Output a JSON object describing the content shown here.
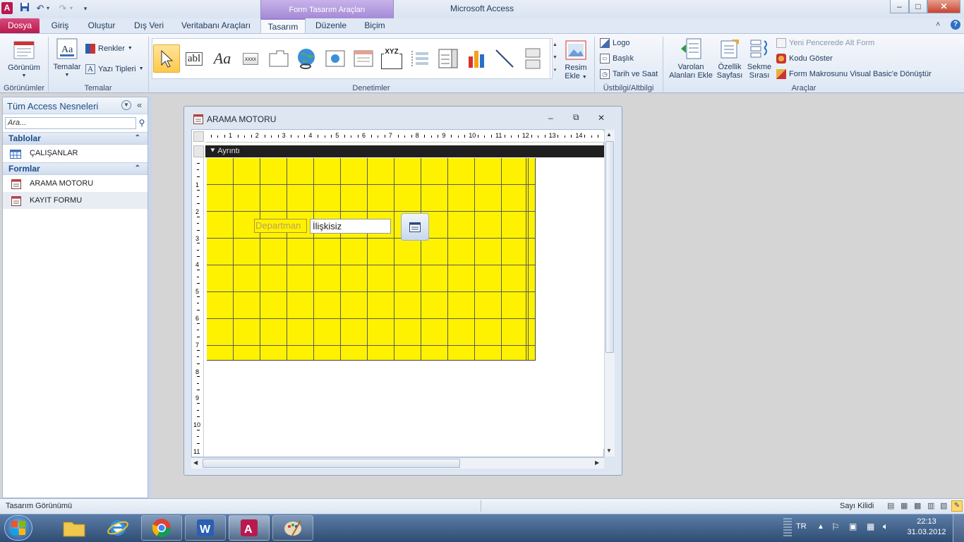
{
  "window": {
    "title": "Microsoft Access",
    "contextual_tab_group": "Form Tasarım Araçları",
    "minimize": "–",
    "maximize": "□",
    "close": "✕"
  },
  "tabs": [
    "Dosya",
    "Giriş",
    "Oluştur",
    "Dış Veri",
    "Veritabanı Araçları",
    "Tasarım",
    "Düzenle",
    "Biçim"
  ],
  "ribbon": {
    "gorunumler": {
      "view_button": "Görünüm",
      "group": "Görünümler"
    },
    "temalar": {
      "themes_button": "Temalar",
      "colors": "Renkler",
      "fonts": "Yazı Tipleri",
      "group": "Temalar"
    },
    "denetimler": {
      "group": "Denetimler",
      "insert_image": "Resim",
      "insert_image_2": "Ekle",
      "textbox_icon": "abl",
      "label_icon": "Aa",
      "button_icon": "xxxx",
      "option_group_icon": "XYZ"
    },
    "ustbilgi": {
      "logo": "Logo",
      "title": "Başlık",
      "datetime": "Tarih ve Saat",
      "group": "Üstbilgi/Altbilgi"
    },
    "araclar": {
      "add_fields_1": "Varolan",
      "add_fields_2": "Alanları Ekle",
      "prop_sheet_1": "Özellik",
      "prop_sheet_2": "Sayfası",
      "tab_order_1": "Sekme",
      "tab_order_2": "Sırası",
      "subform_window": "Yeni Pencerede Alt Form",
      "view_code": "Kodu Göster",
      "convert_macros": "Form Makrosunu Visual Basic'e Dönüştür",
      "group": "Araçlar"
    }
  },
  "nav": {
    "header": "Tüm Access Nesneleri",
    "search_placeholder": "Ara...",
    "groups": [
      {
        "label": "Tablolar",
        "items": [
          "ÇALIŞANLAR"
        ]
      },
      {
        "label": "Formlar",
        "items": [
          "ARAMA MOTORU",
          "KAYIT FORMU"
        ]
      }
    ]
  },
  "form": {
    "title": "ARAMA MOTORU",
    "section": "Ayrıntı",
    "label_departman": "Departman",
    "textbox_value": "İlişkisiz",
    "hruler": [
      "1",
      "2",
      "3",
      "4",
      "5",
      "6",
      "7",
      "8",
      "9",
      "10",
      "11",
      "12",
      "13",
      "14"
    ],
    "vruler": [
      "1",
      "2",
      "3",
      "4",
      "5",
      "6",
      "7",
      "8",
      "9",
      "10",
      "11"
    ]
  },
  "status": {
    "left": "Tasarım Görünümü",
    "right": "Sayı Kilidi"
  },
  "taskbar": {
    "lang": "TR",
    "time": "22:13",
    "date": "31.03.2012"
  },
  "colors": {
    "accent": "#b81a4f",
    "contextual": "#a58ad6",
    "form_background": "#fff200"
  }
}
